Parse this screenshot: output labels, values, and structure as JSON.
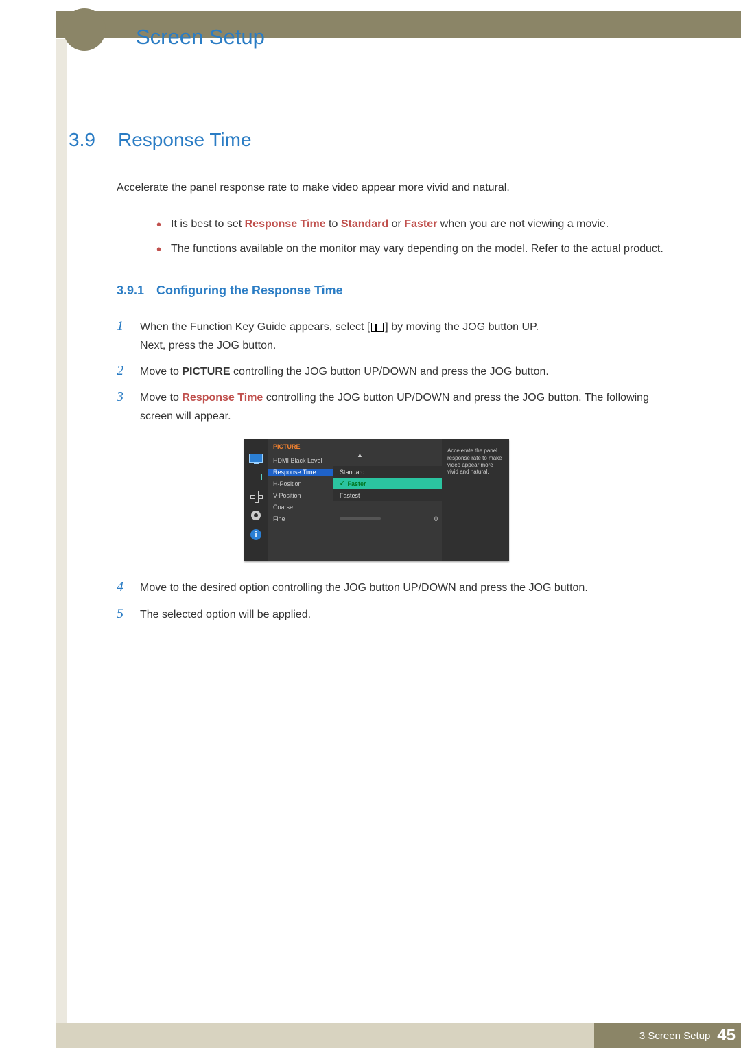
{
  "header": {
    "chapter_title": "Screen Setup"
  },
  "section": {
    "number": "3.9",
    "title": "Response Time",
    "intro": "Accelerate the panel response rate to make video appear more vivid and natural.",
    "bullets": {
      "b1": {
        "pre": "It is best to set ",
        "rt": "Response Time",
        "mid1": " to ",
        "std": "Standard",
        "mid2": " or ",
        "fast": "Faster",
        "post": " when you are not viewing a movie."
      },
      "b2": "The functions available on the monitor may vary depending on the model. Refer to the actual product."
    }
  },
  "subsection": {
    "number": "3.9.1",
    "title": "Configuring the Response Time"
  },
  "steps": {
    "s1a": "When the Function Key Guide appears, select [",
    "s1b": "] by moving the JOG button UP.",
    "s1c": "Next, press the JOG button.",
    "s2a": "Move to ",
    "s2_pic": "PICTURE",
    "s2b": " controlling the JOG button UP/DOWN and press the JOG button.",
    "s3a": "Move to ",
    "s3_rt": "Response Time",
    "s3b": " controlling the JOG button UP/DOWN and press the JOG button. The following screen will appear.",
    "s4": "Move to the desired option controlling the JOG button UP/DOWN and press the JOG button.",
    "s5": "The selected option will be applied."
  },
  "osd": {
    "header": "PICTURE",
    "up_arrow": "▲",
    "info_glyph": "i",
    "menu": {
      "hdmi": "HDMI Black Level",
      "rt": "Response Time",
      "hpos": "H-Position",
      "vpos": "V-Position",
      "coarse": "Coarse",
      "fine": "Fine"
    },
    "options": {
      "standard": "Standard",
      "faster": "Faster",
      "fastest": "Fastest"
    },
    "check": "✓",
    "fine_val": "0",
    "desc": "Accelerate the panel response rate to make video appear more vivid and natural."
  },
  "footer": {
    "label": "3 Screen Setup",
    "page": "45"
  }
}
